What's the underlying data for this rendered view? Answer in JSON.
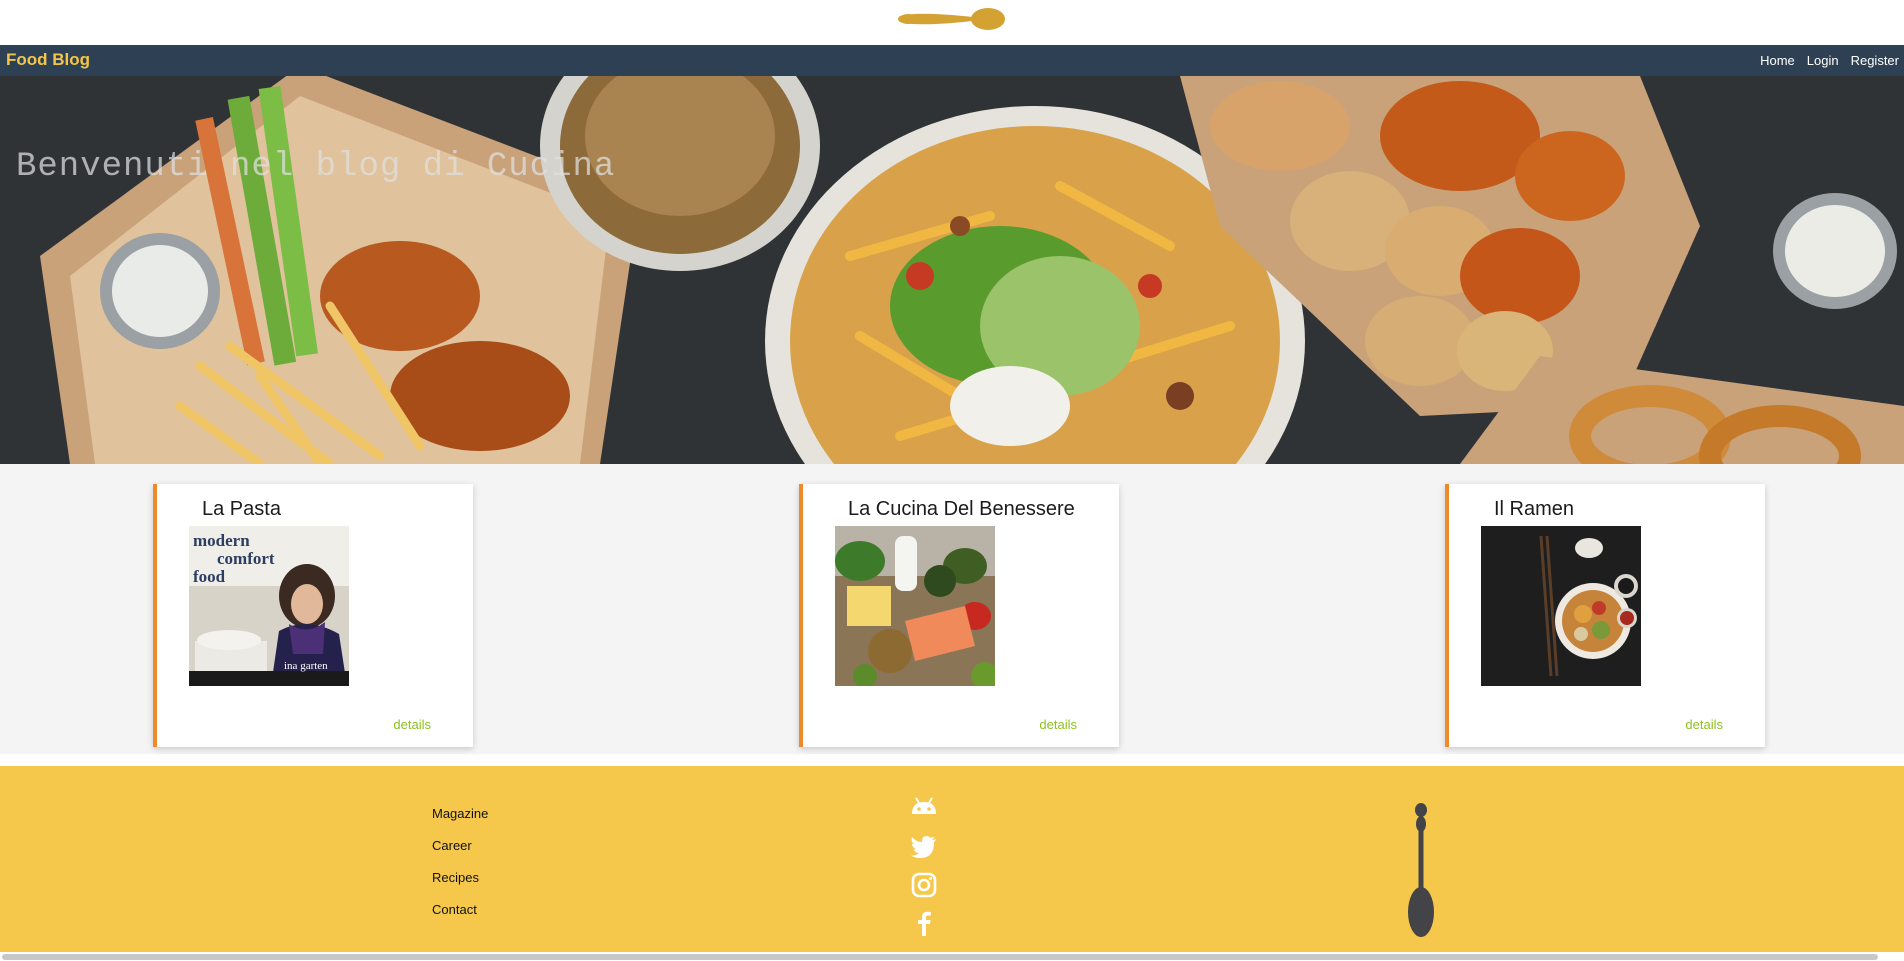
{
  "brand": "Food Blog",
  "nav": [
    "Home",
    "Login",
    "Register"
  ],
  "hero": {
    "title": "Benvenuti nel blog di Cucina"
  },
  "cards": [
    {
      "title": "La Pasta",
      "link": "details",
      "image": "book-cover-modern-comfort-food"
    },
    {
      "title": "La Cucina Del Benessere",
      "link": "details",
      "image": "healthy-food-spread"
    },
    {
      "title": "Il Ramen",
      "link": "details",
      "image": "ramen-bowl"
    }
  ],
  "footer": {
    "links": [
      "Magazine",
      "Career",
      "Recipes",
      "Contact"
    ],
    "social_icons": [
      "android-icon",
      "twitter-icon",
      "instagram-icon",
      "facebook-icon"
    ]
  },
  "image_text": {
    "book_cover": [
      "modern",
      "comfort",
      "food",
      "ina garten"
    ]
  },
  "colors": {
    "navbar": "#2e4154",
    "brand": "#f4c548",
    "footer": "#f5c84b",
    "card_accent": "#ef8a2a",
    "details_link": "#8ec21e"
  }
}
